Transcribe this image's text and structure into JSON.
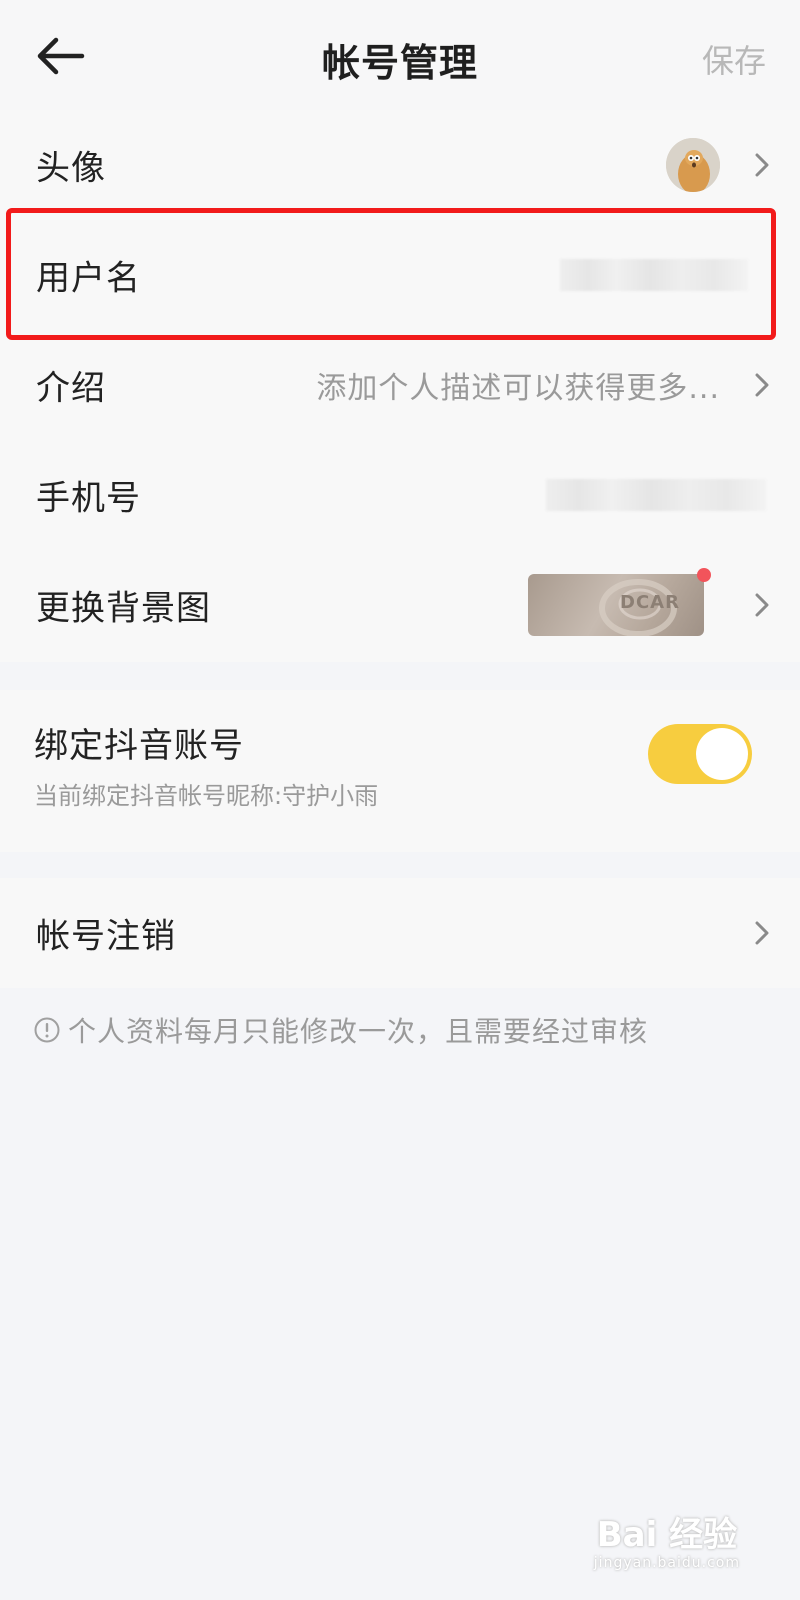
{
  "header": {
    "title": "帐号管理",
    "save_label": "保存"
  },
  "profile_rows": [
    {
      "label": "头像"
    },
    {
      "label": "用户名"
    },
    {
      "label": "介绍",
      "value": "添加个人描述可以获得更多..."
    },
    {
      "label": "手机号"
    },
    {
      "label": "更换背景图",
      "thumb_text": "DCAR"
    }
  ],
  "bind": {
    "title": "绑定抖音账号",
    "subtitle": "当前绑定抖音帐号昵称:守护小雨",
    "enabled": true
  },
  "cancel": {
    "label": "帐号注销"
  },
  "notice": "个人资料每月只能修改一次，且需要经过审核",
  "watermark": {
    "main": "Bai 经验",
    "sub": "jingyan.baidu.com"
  },
  "colors": {
    "accent_toggle": "#f7cd3f",
    "highlight": "#f21b1b",
    "badge": "#f2545b"
  }
}
